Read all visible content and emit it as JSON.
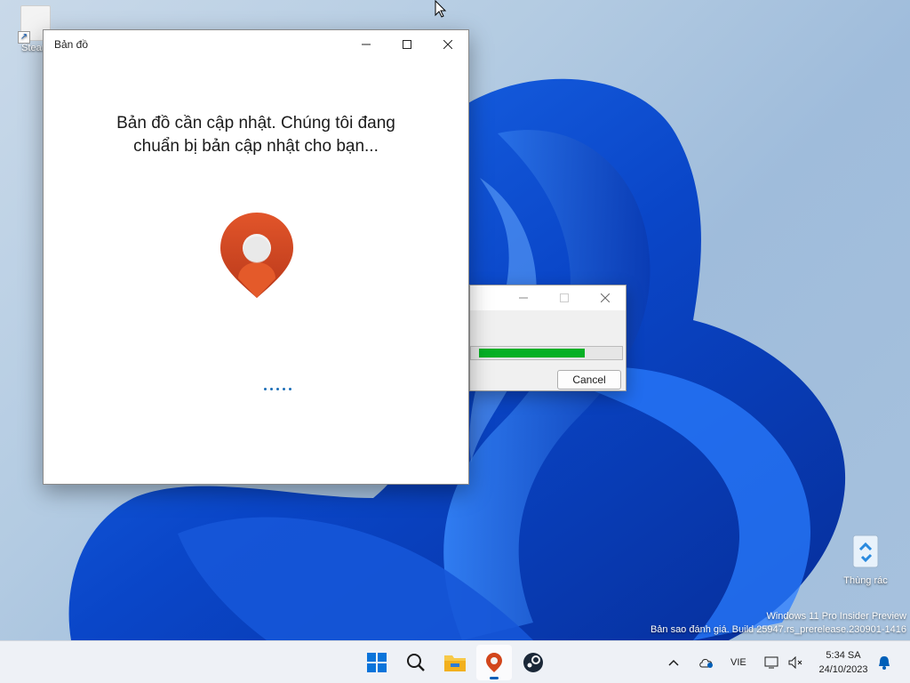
{
  "desktop": {
    "icons": [
      {
        "label": "Steam",
        "icon": "steam-shortcut-icon"
      },
      {
        "label": "Thùng rác",
        "icon": "recycle-bin-icon"
      }
    ],
    "watermark": {
      "line1": "Windows 11 Pro Insider Preview",
      "line2": "Bản sao đánh giá. Build 25947.rs_prerelease.230901-1416"
    }
  },
  "maps_window": {
    "title": "Bản đồ",
    "message_line1": "Bản đồ cần cập nhật. Chúng tôi đang",
    "message_line2": "chuẩn bị bản cập nhật cho bạn...",
    "logo_icon": "maps-pin-logo-icon",
    "controls": [
      "minimize-icon",
      "maximize-icon",
      "close-icon"
    ]
  },
  "progress_dialog": {
    "cancel_label": "Cancel",
    "progress_fraction": 0.75,
    "accent_color": "#06b025"
  },
  "taskbar": {
    "apps": [
      "start-icon",
      "search-icon",
      "file-explorer-icon",
      "maps-icon",
      "steam-icon"
    ],
    "active_app": "maps-icon",
    "tray": {
      "language": "VIE",
      "time": "5:34 SA",
      "date": "24/10/2023"
    }
  },
  "colors": {
    "accent": "#005fb8",
    "maps_brand": "#d2461c"
  }
}
